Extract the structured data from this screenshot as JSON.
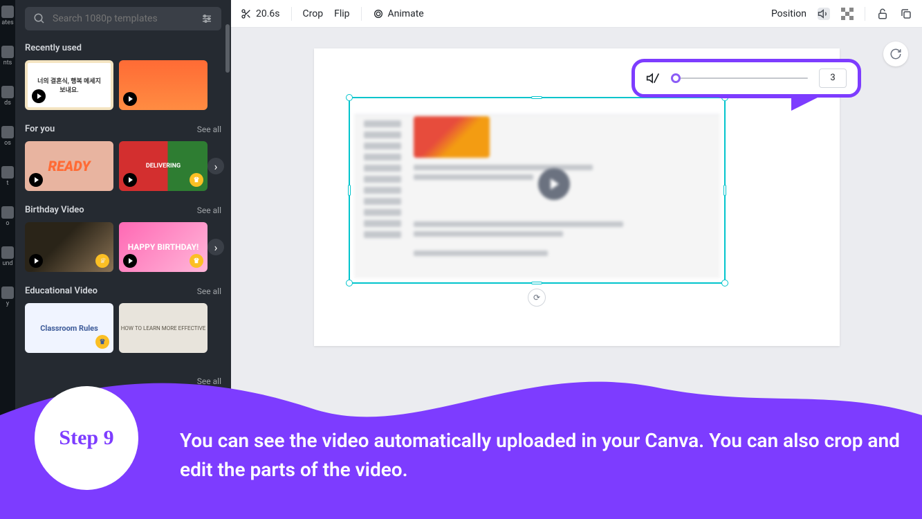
{
  "nav_rail": [
    "ates",
    "nts",
    "ds",
    "os",
    "t",
    "o",
    "und",
    "y"
  ],
  "search": {
    "placeholder": "Search 1080p templates"
  },
  "sections": {
    "recent": {
      "title": "Recently used"
    },
    "foryou": {
      "title": "For you",
      "see_all": "See all"
    },
    "birthday": {
      "title": "Birthday Video",
      "see_all": "See all"
    },
    "educational": {
      "title": "Educational Video",
      "see_all": "See all"
    },
    "last_see_all": "See all"
  },
  "templates": {
    "korean": "너의 결혼식,\n행복 메세지 보내요.",
    "ready": "READY",
    "deliver": "DELIVERING",
    "birthday_text": "HAPPY BIRTHDAY!",
    "classroom": "Classroom Rules",
    "learn": "HOW TO LEARN MORE EFFECTIVE"
  },
  "toolbar": {
    "duration": "20.6s",
    "crop": "Crop",
    "flip": "Flip",
    "animate": "Animate",
    "position": "Position"
  },
  "transparency": {
    "value": "3"
  },
  "tutorial": {
    "step": "Step 9",
    "text": "You can see the video automatically uploaded in your Canva. You can also crop and edit the parts of the video."
  }
}
